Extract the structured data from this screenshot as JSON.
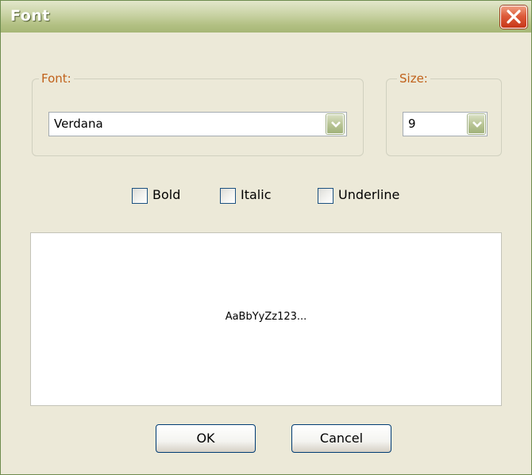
{
  "window": {
    "title": "Font"
  },
  "font_group": {
    "legend": "Font:",
    "value": "Verdana"
  },
  "size_group": {
    "legend": "Size:",
    "value": "9"
  },
  "styles": {
    "bold": "Bold",
    "italic": "Italic",
    "underline": "Underline",
    "bold_checked": false,
    "italic_checked": false,
    "underline_checked": false
  },
  "preview": {
    "sample_text": "AaBbYyZz123..."
  },
  "buttons": {
    "ok": "OK",
    "cancel": "Cancel"
  },
  "colors": {
    "title_bar": "#B3C184",
    "legend_text": "#C0611A",
    "close_button": "#DD5B3A",
    "face": "#ECE9D8"
  },
  "icons": {
    "close": "close-icon",
    "dropdown": "chevron-down-icon"
  }
}
